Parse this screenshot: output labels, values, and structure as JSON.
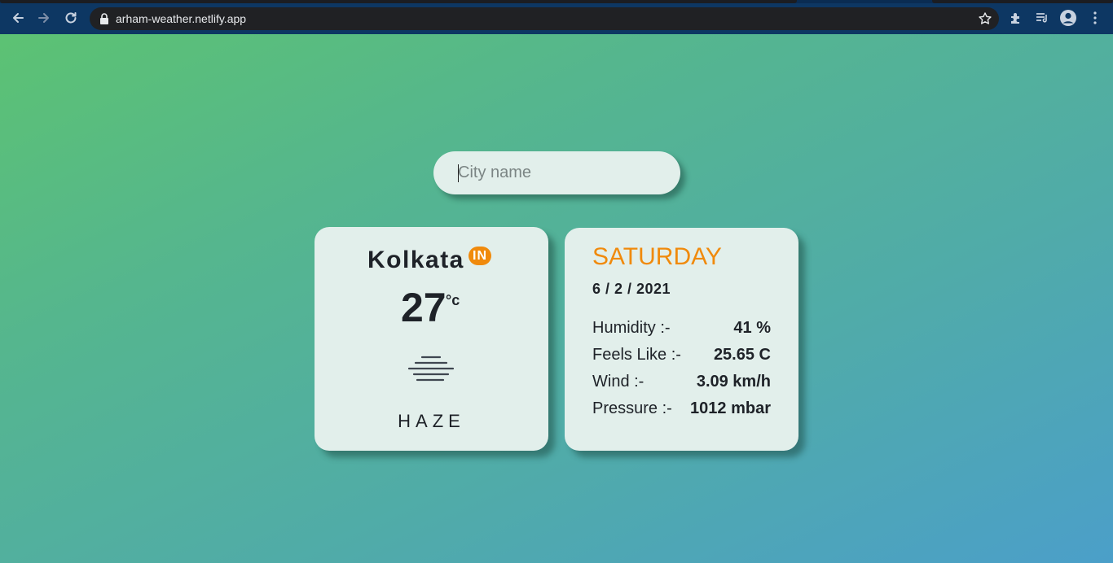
{
  "browser": {
    "url": "arham-weather.netlify.app",
    "icons": [
      "back-arrow-icon",
      "forward-arrow-icon",
      "reload-icon",
      "lock-icon",
      "star-icon",
      "extensions-icon",
      "reading-list-icon",
      "profile-icon",
      "more-vert-icon"
    ]
  },
  "search": {
    "placeholder": "City name",
    "value": ""
  },
  "weather": {
    "city": "Kolkata",
    "country": "IN",
    "temperature": "27",
    "unit": "°c",
    "icon": "haze-icon",
    "condition": "HAZE"
  },
  "details": {
    "day": "SATURDAY",
    "date": "6 / 2 / 2021",
    "rows": [
      {
        "label": "Humidity :-",
        "value": "41 %"
      },
      {
        "label": "Feels Like :-",
        "value": "25.65 C"
      },
      {
        "label": "Wind :-",
        "value": "3.09 km/h"
      },
      {
        "label": "Pressure :-",
        "value": "1012 mbar"
      }
    ]
  },
  "colors": {
    "accent": "#f08a0c",
    "card": "#e2efeb",
    "text": "#1e2228",
    "chrome": "#0d3763"
  }
}
